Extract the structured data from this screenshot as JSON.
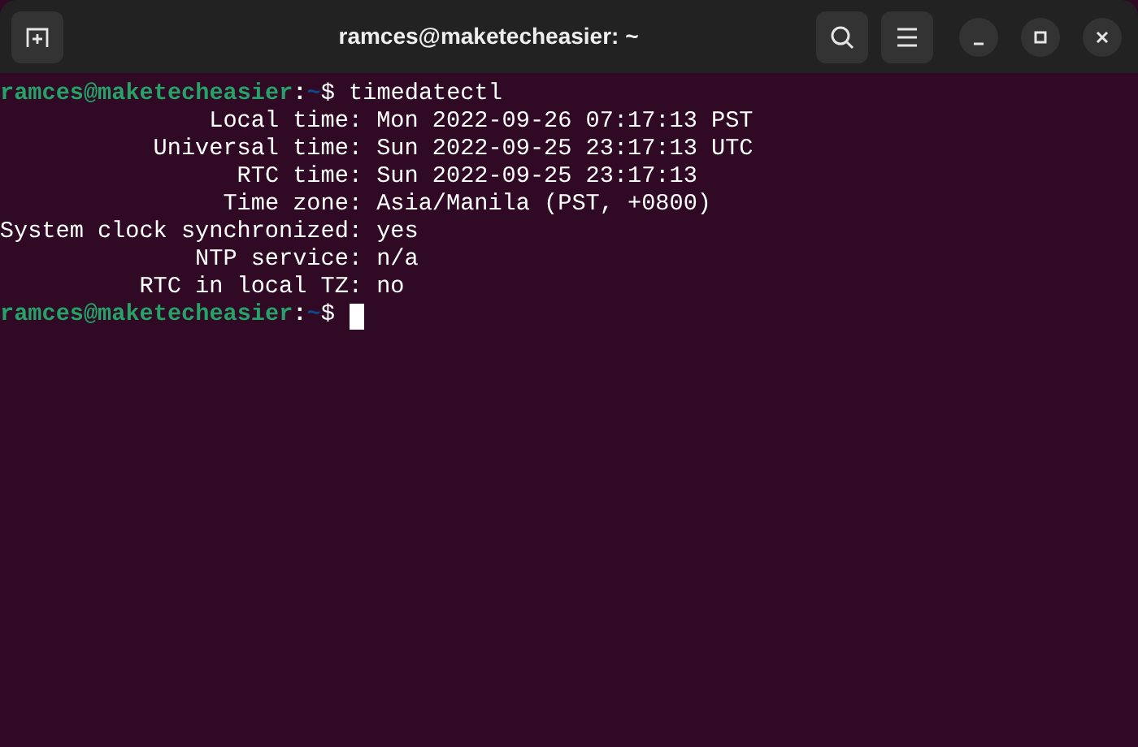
{
  "window": {
    "title": "ramces@maketecheasier: ~"
  },
  "terminal": {
    "lines": [
      {
        "kind": "prompt",
        "user_host": "ramces@maketecheasier",
        "separator": ":",
        "path": "~",
        "symbol": "$",
        "command": "timedatectl",
        "cursor": false
      },
      {
        "kind": "field",
        "label": "Local time:",
        "value": "Mon 2022-09-26 07:17:13 PST"
      },
      {
        "kind": "field",
        "label": "Universal time:",
        "value": "Sun 2022-09-25 23:17:13 UTC"
      },
      {
        "kind": "field",
        "label": "RTC time:",
        "value": "Sun 2022-09-25 23:17:13"
      },
      {
        "kind": "field",
        "label": "Time zone:",
        "value": "Asia/Manila (PST, +0800)"
      },
      {
        "kind": "field",
        "label": "System clock synchronized:",
        "value": "yes"
      },
      {
        "kind": "field",
        "label": "NTP service:",
        "value": "n/a"
      },
      {
        "kind": "field",
        "label": "RTC in local TZ:",
        "value": "no"
      },
      {
        "kind": "prompt",
        "user_host": "ramces@maketecheasier",
        "separator": ":",
        "path": "~",
        "symbol": "$",
        "cursor": true
      }
    ]
  }
}
